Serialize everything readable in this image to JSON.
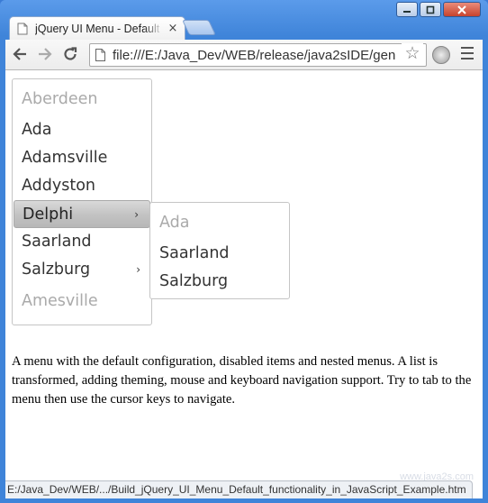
{
  "browser": {
    "tab_title": "jQuery UI Menu - Default functionality",
    "tab_close": "×",
    "url": "file:///E:/Java_Dev/WEB/release/java2sIDE/gen",
    "status_url": "E:/Java_Dev/WEB/.../Build_jQuery_UI_Menu_Default_functionality_in_JavaScript_Example.htm",
    "watermark": "www.java2s.com"
  },
  "menu": {
    "items": [
      {
        "label": "Aberdeen",
        "disabled": true
      },
      {
        "label": "Ada"
      },
      {
        "label": "Adamsville"
      },
      {
        "label": "Addyston"
      },
      {
        "label": "Delphi",
        "active": true,
        "has_submenu": true
      },
      {
        "label": "Saarland"
      },
      {
        "label": "Salzburg",
        "has_submenu": true
      },
      {
        "label": "Amesville",
        "disabled": true
      }
    ],
    "submenu": [
      {
        "label": "Ada",
        "disabled": true
      },
      {
        "label": "Saarland"
      },
      {
        "label": "Salzburg"
      }
    ],
    "caret": "›"
  },
  "description": "A menu with the default configuration, disabled items and nested menus. A list is transformed, adding theming, mouse and keyboard navigation support. Try to tab to the menu then use the cursor keys to navigate."
}
